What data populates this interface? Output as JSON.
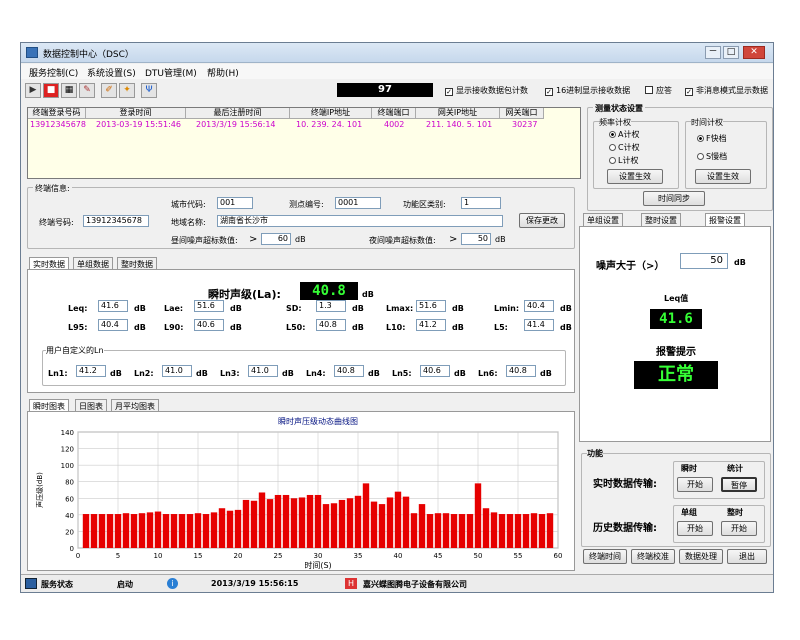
{
  "window": {
    "title": "数据控制中心（DSC）",
    "min": "－",
    "max": "□",
    "close": "✕"
  },
  "menu": [
    "服务控制(C)",
    "系统设置(S)",
    "DTU管理(M)",
    "帮助(H)"
  ],
  "toolbar": {
    "counter": "97",
    "opts": [
      "显示接收数据包计数",
      "16进制显示接收数据",
      "应答",
      "非消息模式显示数据"
    ],
    "checked": [
      true,
      true,
      false,
      true
    ]
  },
  "grid": {
    "headers": [
      "终端登录号码",
      "登录时间",
      "最后注册时间",
      "终端IP地址",
      "终端端口",
      "网关IP地址",
      "网关端口"
    ],
    "row": [
      "13912345678",
      "2013-03-19 15:51:46",
      "2013/3/19 15:56:14",
      "10. 239. 24. 101",
      "4002",
      "211. 140. 5. 101",
      "30237"
    ]
  },
  "measure": {
    "title": "测量状态设置",
    "freq_title": "频率计权",
    "freq": [
      "A计权",
      "C计权",
      "L计权"
    ],
    "time_title": "时间计权",
    "time": [
      "F快档",
      "S慢档"
    ],
    "apply": "设置生效",
    "apply2": "设置生效",
    "sync": "时间同步"
  },
  "info": {
    "title": "终端信息:",
    "city_lbl": "城市代码:",
    "city": "001",
    "point_lbl": "测点编号:",
    "point": "0001",
    "zone_lbl": "功能区类别:",
    "zone": "1",
    "num_lbl": "终端号码:",
    "num": "13912345678",
    "addr_lbl": "地域名称:",
    "addr": "湖南省长沙市",
    "save": "保存更改",
    "day_lbl": "昼间噪声超标数值:",
    "day_op": ">",
    "day_val": "60",
    "day_unit": "dB",
    "night_lbl": "夜间噪声超标数值:",
    "night_op": ">",
    "night_val": "50",
    "night_unit": "dB"
  },
  "tabs1": [
    "实时数据",
    "单组数据",
    "整时数据"
  ],
  "realtime": {
    "la_lbl": "瞬时声级(La):",
    "la": "40.8",
    "unit": "dB",
    "stats": [
      [
        "Leq:",
        "41.6"
      ],
      [
        "Lae:",
        "51.6"
      ],
      [
        "SD:",
        "1.3"
      ],
      [
        "Lmax:",
        "51.6"
      ],
      [
        "Lmin:",
        "40.4"
      ],
      [
        "L95:",
        "40.4"
      ],
      [
        "L90:",
        "40.6"
      ],
      [
        "L50:",
        "40.8"
      ],
      [
        "L10:",
        "41.2"
      ],
      [
        "L5:",
        "41.4"
      ]
    ],
    "custom_title": "用户自定义的Ln",
    "ln": [
      [
        "Ln1:",
        "41.2"
      ],
      [
        "Ln2:",
        "41.0"
      ],
      [
        "Ln3:",
        "41.0"
      ],
      [
        "Ln4:",
        "40.8"
      ],
      [
        "Ln5:",
        "40.6"
      ],
      [
        "Ln6:",
        "40.8"
      ]
    ]
  },
  "tabs2": [
    "单组设置",
    "整时设置",
    "报警设置"
  ],
  "alarm": {
    "noise_lbl": "噪声大于（>）",
    "noise_val": "50",
    "unit": "dB",
    "leq_lbl": "Leq值",
    "leq": "41.6",
    "warn_lbl": "报警提示",
    "warn": "正常"
  },
  "tabs3": [
    "瞬时图表",
    "日图表",
    "月平均图表"
  ],
  "chart_data": {
    "type": "bar",
    "title": "瞬时声压级动态曲线图",
    "xlabel": "时间(S)",
    "ylabel": "声压级(dB)",
    "ylim": [
      0,
      140
    ],
    "xlim": [
      0,
      60
    ],
    "yticks": [
      "0",
      "20",
      "40",
      "60",
      "80",
      "100",
      "120",
      "140"
    ],
    "xticks": [
      "0",
      "5",
      "10",
      "15",
      "20",
      "25",
      "30",
      "35",
      "40",
      "45",
      "50",
      "55",
      "60"
    ],
    "x": [
      1,
      2,
      3,
      4,
      5,
      6,
      7,
      8,
      9,
      10,
      11,
      12,
      13,
      14,
      15,
      16,
      17,
      18,
      19,
      20,
      21,
      22,
      23,
      24,
      25,
      26,
      27,
      28,
      29,
      30,
      31,
      32,
      33,
      34,
      35,
      36,
      37,
      38,
      39,
      40,
      41,
      42,
      43,
      44,
      45,
      46,
      47,
      48,
      49,
      50,
      51,
      52,
      53,
      54,
      55,
      56,
      57,
      58,
      59
    ],
    "values": [
      41,
      41,
      41,
      41,
      41,
      42,
      41,
      42,
      43,
      44,
      41,
      41,
      41,
      41,
      42,
      41,
      43,
      48,
      45,
      46,
      58,
      57,
      67,
      59,
      64,
      64,
      60,
      61,
      64,
      64,
      53,
      54,
      58,
      60,
      63,
      78,
      56,
      53,
      61,
      68,
      62,
      42,
      53,
      41,
      42,
      42,
      41,
      41,
      41,
      78,
      48,
      43,
      41,
      41,
      41,
      41,
      42,
      41,
      42
    ],
    "color": "#e60000"
  },
  "func": {
    "title": "功能",
    "rt_lbl": "实时数据传输:",
    "h1": "瞬时",
    "h2": "统计",
    "start": "开始",
    "pause": "暂停",
    "hist_lbl": "历史数据传输:",
    "h3": "单组",
    "h4": "整时",
    "start2": "开始",
    "start3": "开始"
  },
  "bottom_buttons": [
    "终端时间",
    "终端校准",
    "数据处理",
    "退出"
  ],
  "status": {
    "state_lbl": "服务状态",
    "state": "启动",
    "time": "2013/3/19 15:56:15",
    "company": "嘉兴蝶图腾电子设备有限公司"
  }
}
